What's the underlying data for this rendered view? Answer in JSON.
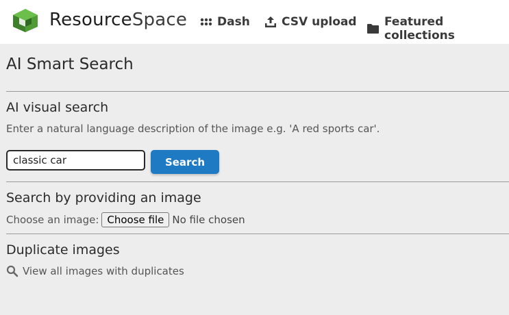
{
  "header": {
    "brand_part1": "Resource",
    "brand_part2": "Space",
    "nav": [
      {
        "label": "Dash",
        "icon": "grid-icon"
      },
      {
        "label": "CSV upload",
        "icon": "upload-icon"
      },
      {
        "label": "Featured collections",
        "icon": "folder-icon"
      }
    ],
    "colors": {
      "brand_green": "#5a9f3a",
      "accent_blue": "#1f7ac4"
    }
  },
  "main": {
    "page_title": "AI Smart Search",
    "visual_search": {
      "title": "AI visual search",
      "description": "Enter a natural language description of the image e.g. 'A red sports car'.",
      "input_value": "classic car",
      "button_label": "Search"
    },
    "image_search": {
      "title": "Search by providing an image",
      "label": "Choose an image:",
      "file_button": "Choose file",
      "file_status": "No file chosen"
    },
    "duplicates": {
      "title": "Duplicate images",
      "link_label": "View all images with duplicates",
      "link_icon": "search-icon"
    }
  }
}
